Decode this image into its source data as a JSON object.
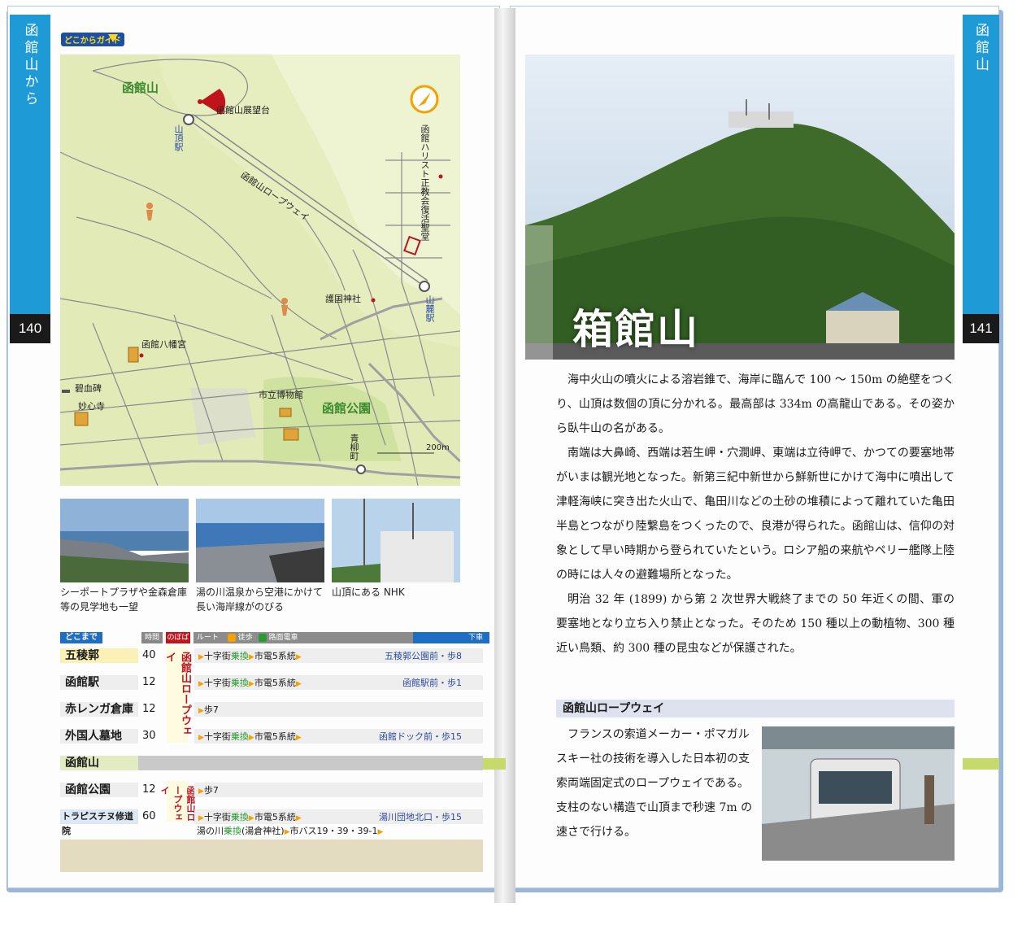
{
  "left_page": {
    "tab_label": "函館山から",
    "page_number": "140",
    "guide_tag": "どこからガイド",
    "map": {
      "title": "函館山",
      "park_name": "函館公園",
      "scale": "200m",
      "labels": {
        "observatory": "函館山展望台",
        "summit_station": "山頂駅",
        "ropeway": "函館山ロープウェイ",
        "church": "函館ハリスト正教会復活聖堂",
        "shrine": "護国神社",
        "foot_station": "山麓駅",
        "hachimangu": "函館八幡宮",
        "hekketsuhi": "碧血碑",
        "myoshinji": "妙心寺",
        "museum": "市立博物館",
        "aoyagicho": "青柳町"
      }
    },
    "photos": [
      {
        "caption": "シーポートプラザや金森倉庫等の見学地も一望"
      },
      {
        "caption": "湯の川温泉から空港にかけて長い海岸線がのびる"
      },
      {
        "caption": "山頂にある NHK"
      }
    ],
    "route_table": {
      "header": {
        "from": "どこまで",
        "time": "時間",
        "nobori": "のぼば",
        "route": "ルート",
        "walk": "徒歩",
        "tram": "路面電車",
        "alight": "下車"
      },
      "ropeway_label": "函館山ロープウェイ",
      "ropeway_label2": "函館山ロープウェイ",
      "rows": [
        {
          "dest": "五稜郭",
          "mins": "40",
          "route_a": "十字街",
          "transfer": "乗換",
          "route_b": "市電5系統",
          "stop": "五稜郭公園前・歩8"
        },
        {
          "dest": "函館駅",
          "mins": "12",
          "route_a": "十字街",
          "transfer": "乗換",
          "route_b": "市電5系統",
          "stop": "函館駅前・歩1"
        },
        {
          "dest": "赤レンガ倉庫",
          "mins": "12",
          "route_a": "歩7"
        },
        {
          "dest": "外国人墓地",
          "mins": "30",
          "route_a": "十字街",
          "transfer": "乗換",
          "route_b": "市電5系統",
          "stop": "函館ドック前・歩15"
        },
        {
          "dest": "函館公園",
          "mins": "12",
          "route_a": "歩7"
        },
        {
          "dest": "トラピスチヌ修道院",
          "mins": "60",
          "route_a": "十字街",
          "transfer": "乗換",
          "route_b": "市電5系統",
          "stop": "湯川団地北口・歩15",
          "extra_a": "湯の川",
          "extra_transfer": "乗換",
          "extra_b": "(湯倉神社)",
          "extra_c": "市バス19・39・39-1"
        }
      ],
      "divider": "函館山"
    }
  },
  "right_page": {
    "tab_label": "函館山",
    "page_number": "141",
    "title": "箱館山",
    "paragraphs": [
      "海中火山の噴火による溶岩錐で、海岸に臨んで 100 〜 150m の絶壁をつくり、山頂は数個の頂に分かれる。最高部は 334m の高龍山である。その姿から臥牛山の名がある。",
      "南端は大鼻崎、西端は若生岬・穴澗岬、東端は立待岬で、かつての要塞地帯がいまは観光地となった。新第三紀中新世から鮮新世にかけて海中に噴出して津軽海峡に突き出た火山で、亀田川などの土砂の堆積によって離れていた亀田半島とつながり陸繋島をつくったので、良港が得られた。函館山は、信仰の対象として早い時期から登られていたという。ロシア船の来航やペリー艦隊上陸の時には人々の避難場所となった。",
      "明治 32 年 (1899) から第 2 次世界大戦終了までの 50 年近くの間、軍の要塞地となり立ち入り禁止となった。そのため 150 種以上の動植物、300 種近い鳥類、約 300 種の昆虫などが保護された。"
    ],
    "section": {
      "heading": "函館山ロープウェイ",
      "text": "フランスの索道メーカー・ポマガルスキー社の技術を導入した日本初の支索両端固定式のロープウェイである。支柱のない構造で山頂まで秒速 7m の速さで行ける。"
    }
  }
}
